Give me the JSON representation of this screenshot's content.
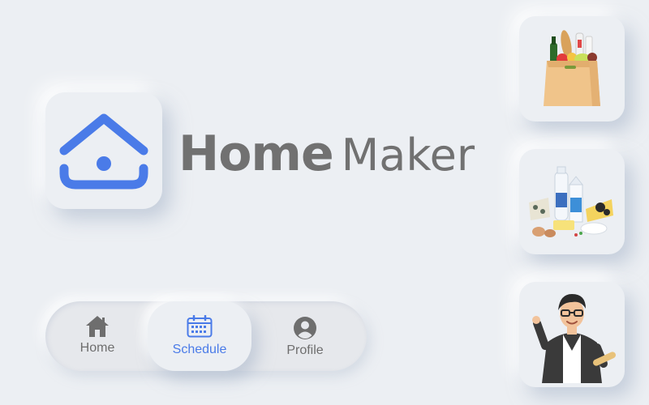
{
  "brand": {
    "name_part1": "Home",
    "name_part2": "Maker"
  },
  "nav": {
    "items": [
      {
        "label": "Home",
        "icon": "house-icon",
        "active": false
      },
      {
        "label": "Schedule",
        "icon": "calendar-icon",
        "active": true
      },
      {
        "label": "Profile",
        "icon": "user-circle-icon",
        "active": false
      }
    ]
  },
  "cards": [
    {
      "icon": "grocery-bag-icon"
    },
    {
      "icon": "dairy-products-icon"
    },
    {
      "icon": "chef-person-icon"
    }
  ],
  "colors": {
    "accent": "#4A7BE8",
    "background": "#ECEFF3",
    "wordmark": "#717171",
    "nav_inactive": "#6E6E6E"
  }
}
